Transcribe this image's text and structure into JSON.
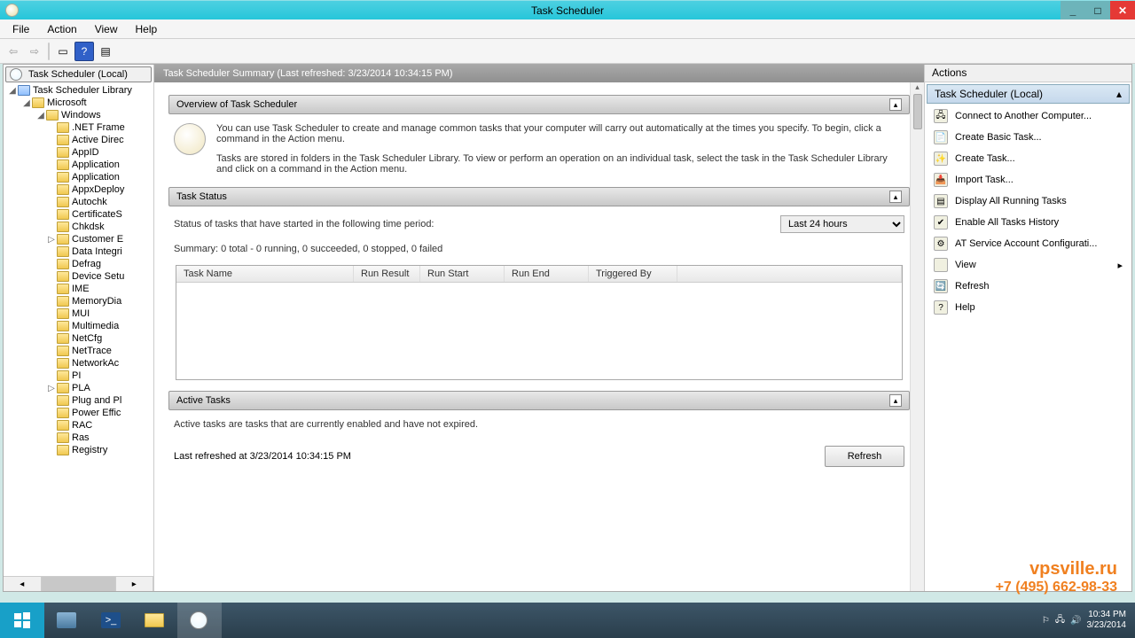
{
  "window": {
    "title": "Task Scheduler"
  },
  "menu": {
    "file": "File",
    "action": "Action",
    "view": "View",
    "help": "Help"
  },
  "tree": {
    "root": "Task Scheduler (Local)",
    "library": "Task Scheduler Library",
    "microsoft": "Microsoft",
    "windows": "Windows",
    "items": [
      ".NET Frame",
      "Active Direc",
      "AppID",
      "Application",
      "Application",
      "AppxDeploy",
      "Autochk",
      "CertificateS",
      "Chkdsk",
      "Customer E",
      "Data Integri",
      "Defrag",
      "Device Setu",
      "IME",
      "MemoryDia",
      "MUI",
      "Multimedia",
      "NetCfg",
      "NetTrace",
      "NetworkAc",
      "PI",
      "PLA",
      "Plug and Pl",
      "Power Effic",
      "RAC",
      "Ras",
      "Registry"
    ]
  },
  "center": {
    "header": "Task Scheduler Summary (Last refreshed: 3/23/2014 10:34:15 PM)",
    "overview_title": "Overview of Task Scheduler",
    "overview_text1": "You can use Task Scheduler to create and manage common tasks that your computer will carry out automatically at the times you specify. To begin, click a command in the Action menu.",
    "overview_text2": "Tasks are stored in folders in the Task Scheduler Library. To view or perform an operation on an individual task, select the task in the Task Scheduler Library and click on a command in the Action menu.",
    "status_title": "Task Status",
    "status_label": "Status of tasks that have started in the following time period:",
    "status_period": "Last 24 hours",
    "status_summary": "Summary: 0 total - 0 running, 0 succeeded, 0 stopped, 0 failed",
    "cols": {
      "name": "Task Name",
      "result": "Run Result",
      "start": "Run Start",
      "end": "Run End",
      "trigger": "Triggered By"
    },
    "active_title": "Active Tasks",
    "active_text": "Active tasks are tasks that are currently enabled and have not expired.",
    "last_refreshed": "Last refreshed at 3/23/2014 10:34:15 PM",
    "refresh_btn": "Refresh"
  },
  "actions": {
    "title": "Actions",
    "scope": "Task Scheduler (Local)",
    "items": [
      "Connect to Another Computer...",
      "Create Basic Task...",
      "Create Task...",
      "Import Task...",
      "Display All Running Tasks",
      "Enable All Tasks History",
      "AT Service Account Configurati...",
      "View",
      "Refresh",
      "Help"
    ]
  },
  "taskbar": {
    "time": "10:34 PM",
    "date": "3/23/2014"
  },
  "watermark": {
    "site": "vpsville.ru",
    "phone": "+7 (495) 662-98-33"
  }
}
